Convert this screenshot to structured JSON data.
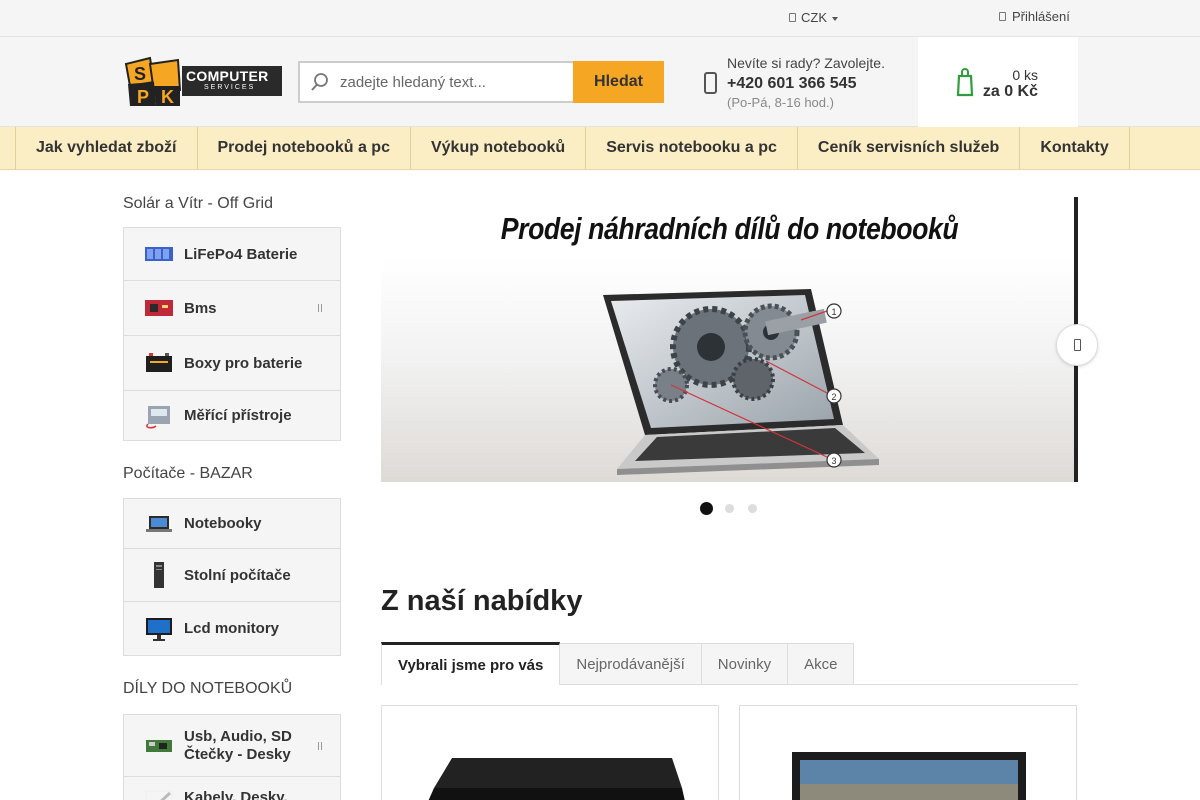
{
  "topbar": {
    "currency": "CZK",
    "login": "Přihlášení"
  },
  "logo": {
    "line1": "COMPUTER",
    "line2": "SERVICES"
  },
  "search": {
    "placeholder": "zadejte hledaný text...",
    "button": "Hledat"
  },
  "contact": {
    "question": "Nevíte si rady? Zavolejte.",
    "phone": "+420 601 366 545",
    "hours": "(Po-Pá, 8-16 hod.)"
  },
  "cart": {
    "quantity": "0 ks",
    "total": "za 0 Kč"
  },
  "nav": [
    "Jak vyhledat zboží",
    "Prodej notebooků a pc",
    "Výkup notebooků",
    "Servis notebooku a pc",
    "Ceník servisních služeb",
    "Kontakty"
  ],
  "sidebar": {
    "groups": [
      {
        "heading": "Solár a Vítr - Off Grid",
        "items": [
          {
            "label": "LiFePo4 Baterie",
            "icon": "battery-icon"
          },
          {
            "label": "Bms",
            "icon": "circuit-board-icon"
          },
          {
            "label": "Boxy pro baterie",
            "icon": "battery-box-icon"
          },
          {
            "label": "Měřící přístroje",
            "icon": "meter-icon"
          }
        ]
      },
      {
        "heading": "Počítače - BAZAR",
        "items": [
          {
            "label": "Notebooky",
            "icon": "laptop-icon"
          },
          {
            "label": "Stolní počítače",
            "icon": "desktop-tower-icon"
          },
          {
            "label": "Lcd monitory",
            "icon": "monitor-icon"
          }
        ]
      },
      {
        "heading": "DÍLY DO NOTEBOOKŮ",
        "items": [
          {
            "label": "Usb, Audio, SD Čtečky - Desky",
            "icon": "pcb-icon"
          },
          {
            "label": "Kabely, Desky,",
            "icon": "cable-icon"
          }
        ]
      }
    ]
  },
  "banner": {
    "title": "Prodej náhradních dílů do notebooků",
    "callouts": [
      "1",
      "2",
      "3"
    ],
    "slide_count": 3,
    "active_slide": 1
  },
  "offers": {
    "title": "Z naší nabídky",
    "tabs": [
      "Vybrali jsme pro vás",
      "Nejprodávanější",
      "Novinky",
      "Akce"
    ]
  },
  "colors": {
    "accent": "#f5a623",
    "nav_bg": "#fbeec5",
    "cart_icon": "#2e9e3e"
  }
}
